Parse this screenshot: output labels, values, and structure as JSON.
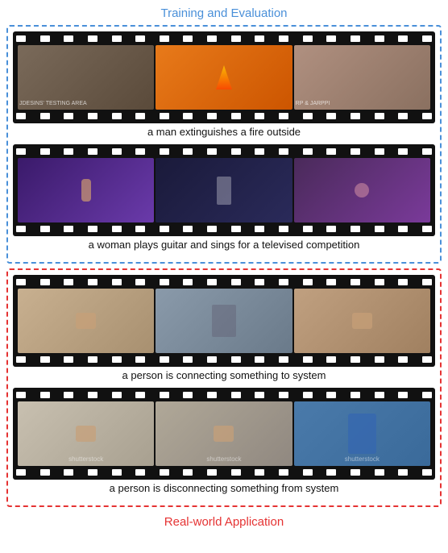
{
  "header": {
    "title": "Training and Evaluation"
  },
  "sections": [
    {
      "id": "training-eval",
      "borderColor": "blue",
      "clips": [
        {
          "caption": "a man extinguishes a fire outside",
          "scenes": [
            "fire1",
            "fire2",
            "fire3"
          ]
        },
        {
          "caption": "a woman plays guitar and sings for a televised competition",
          "scenes": [
            "guitar1",
            "guitar2",
            "guitar3"
          ]
        }
      ]
    },
    {
      "id": "real-world",
      "borderColor": "red",
      "clips": [
        {
          "caption": "a person is connecting something to system",
          "scenes": [
            "connect1",
            "connect2",
            "connect3"
          ]
        },
        {
          "caption": "a person is disconnecting something from system",
          "scenes": [
            "discon1",
            "discon2",
            "discon3"
          ],
          "watermark": "shutterstock"
        }
      ]
    }
  ],
  "footer": {
    "label": "Real-world Application"
  },
  "perfs_count": 18
}
